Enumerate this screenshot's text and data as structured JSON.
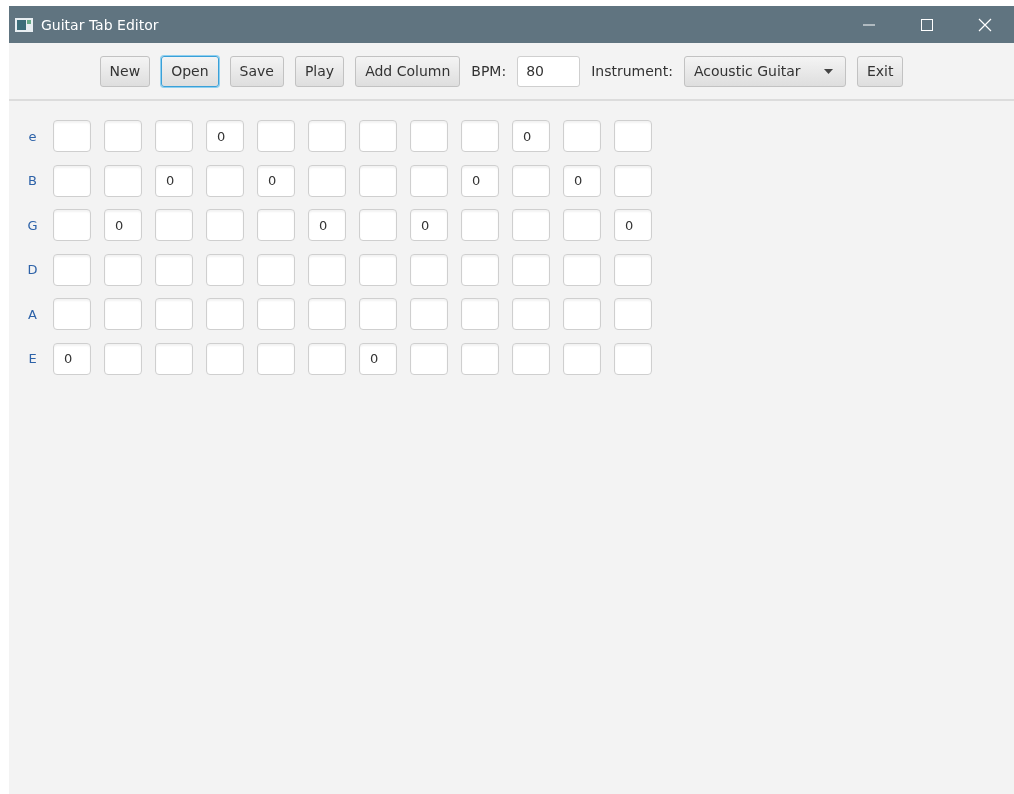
{
  "window": {
    "title": "Guitar Tab Editor"
  },
  "toolbar": {
    "buttons": [
      {
        "label": "New",
        "focused": false
      },
      {
        "label": "Open",
        "focused": true
      },
      {
        "label": "Save",
        "focused": false
      },
      {
        "label": "Play",
        "focused": false
      },
      {
        "label": "Add Column",
        "focused": false
      }
    ],
    "bpm": {
      "label": "BPM:",
      "value": "80"
    },
    "instrument": {
      "label": "Instrument:",
      "value": "Acoustic Guitar"
    },
    "exit_button": {
      "label": "Exit",
      "focused": false
    }
  },
  "tab": {
    "strings": [
      {
        "name": "e",
        "cells": [
          {},
          {},
          {},
          {
            "value": "0"
          },
          {},
          {},
          {},
          {},
          {},
          {
            "value": "0"
          },
          {},
          {}
        ]
      },
      {
        "name": "B",
        "cells": [
          {},
          {},
          {
            "value": "0"
          },
          {},
          {
            "value": "0"
          },
          {},
          {},
          {},
          {
            "value": "0"
          },
          {},
          {
            "value": "0"
          },
          {}
        ]
      },
      {
        "name": "G",
        "cells": [
          {},
          {
            "value": "0"
          },
          {},
          {},
          {},
          {
            "value": "0"
          },
          {},
          {
            "value": "0"
          },
          {},
          {},
          {},
          {
            "value": "0"
          }
        ]
      },
      {
        "name": "D",
        "cells": [
          {},
          {},
          {},
          {},
          {},
          {},
          {},
          {},
          {},
          {},
          {},
          {}
        ]
      },
      {
        "name": "A",
        "cells": [
          {},
          {},
          {},
          {},
          {},
          {},
          {},
          {},
          {},
          {},
          {},
          {}
        ]
      },
      {
        "name": "E",
        "cells": [
          {
            "value": "0"
          },
          {},
          {},
          {},
          {},
          {},
          {
            "value": "0"
          },
          {},
          {},
          {},
          {},
          {}
        ]
      }
    ]
  }
}
